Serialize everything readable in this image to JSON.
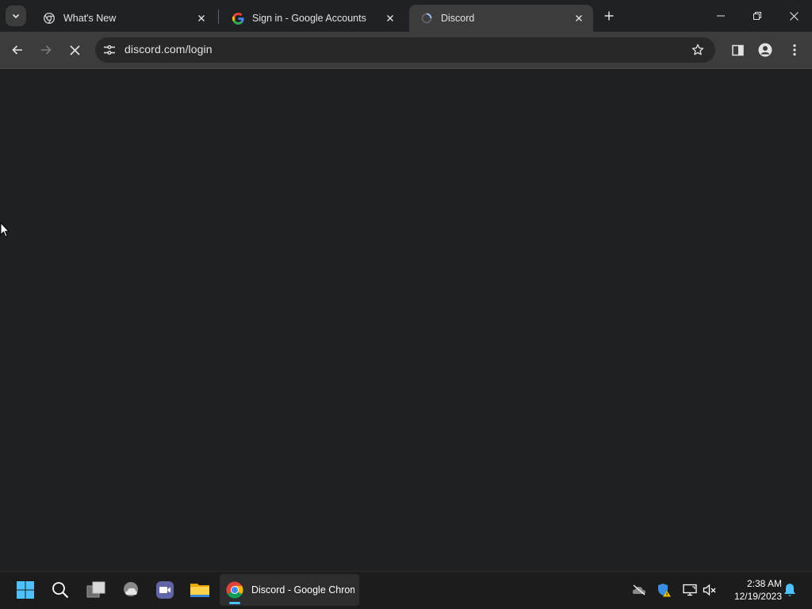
{
  "tabs": [
    {
      "title": "What's New",
      "favicon": "chrome-icon",
      "active": false
    },
    {
      "title": "Sign in - Google Accounts",
      "favicon": "google-g-icon",
      "active": false
    },
    {
      "title": "Discord",
      "favicon": "loading-spinner-icon",
      "active": true
    }
  ],
  "address_bar": {
    "url": "discord.com/login"
  },
  "taskbar": {
    "active_app_label": "Discord - Google Chrome"
  },
  "clock": {
    "time": "2:38 AM",
    "date": "12/19/2023"
  },
  "colors": {
    "page_background": "#1f2023",
    "toolbar": "#3c3c3c",
    "taskbar_accent": "#4cc2ff"
  }
}
